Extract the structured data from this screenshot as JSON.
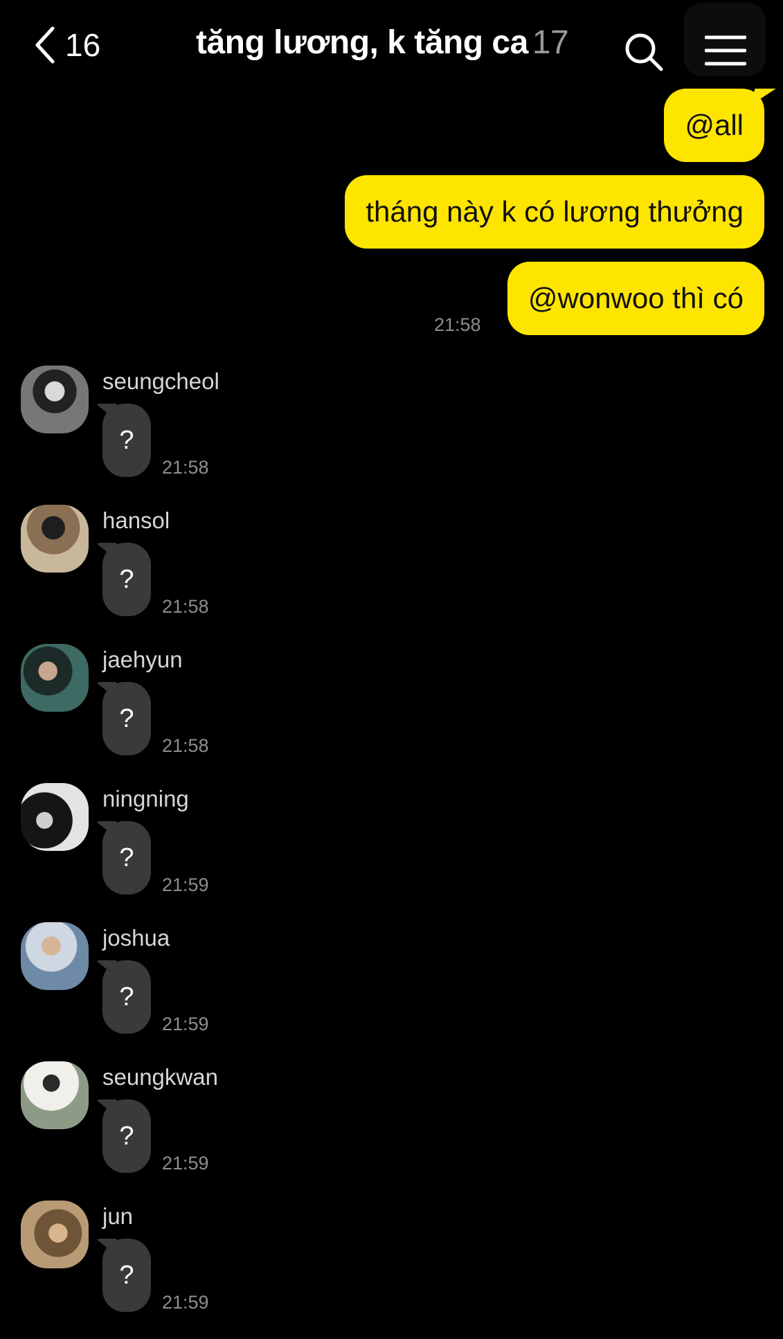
{
  "header": {
    "back_count": "16",
    "title": "tăng lương, k tăng ca",
    "member_count": "17"
  },
  "outgoing": {
    "messages": [
      "@all",
      "tháng này k có lương thưởng",
      "@wonwoo thì có"
    ],
    "time": "21:58"
  },
  "incoming": [
    {
      "sender": "seungcheol",
      "text": "?",
      "time": "21:58",
      "avatar_color": "#6d6d6d"
    },
    {
      "sender": "hansol",
      "text": "?",
      "time": "21:58",
      "avatar_color": "#6b5a44"
    },
    {
      "sender": "jaehyun",
      "text": "?",
      "time": "21:58",
      "avatar_color": "#2f4a46"
    },
    {
      "sender": "ningning",
      "text": "?",
      "time": "21:59",
      "avatar_color": "#5a5a5a"
    },
    {
      "sender": "joshua",
      "text": "?",
      "time": "21:59",
      "avatar_color": "#8fa2b6"
    },
    {
      "sender": "seungkwan",
      "text": "?",
      "time": "21:59",
      "avatar_color": "#a4aaa0"
    },
    {
      "sender": "jun",
      "text": "?",
      "time": "21:59",
      "avatar_color": "#8e7454"
    }
  ],
  "colors": {
    "background": "#000000",
    "outgoing_bubble": "#fee500",
    "incoming_bubble": "#3a3a3c",
    "timestamp": "#8e8e8e"
  },
  "icons": {
    "back": "chevron-left-icon",
    "search": "search-icon",
    "menu": "menu-icon"
  }
}
